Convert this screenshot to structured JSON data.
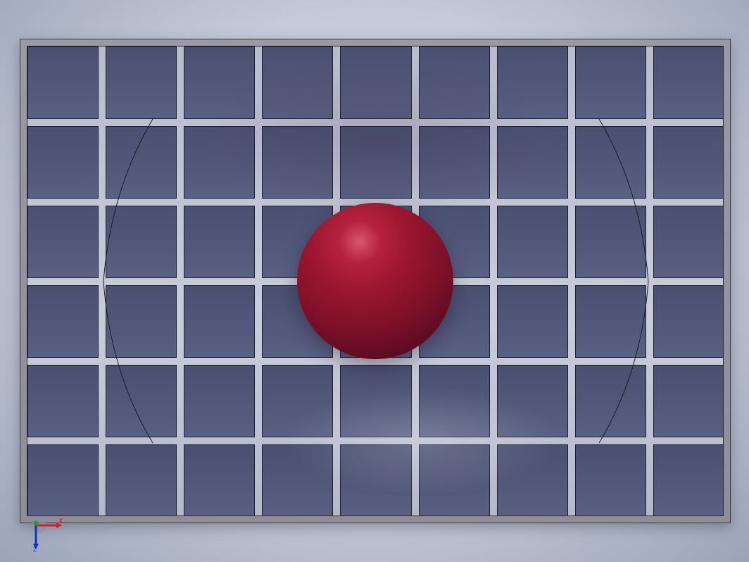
{
  "scene": {
    "background_color": "#c4cbd8",
    "frame_color": "#8e8e98",
    "tile_color": "#525879",
    "sphere_color": "#9a1530"
  },
  "grid": {
    "columns": 9,
    "rows": 6
  },
  "triad": {
    "x_label": "X",
    "y_label": "Y",
    "z_label": "Z",
    "x_color": "#d82020",
    "y_color": "#18a030",
    "z_color": "#1030c0"
  }
}
